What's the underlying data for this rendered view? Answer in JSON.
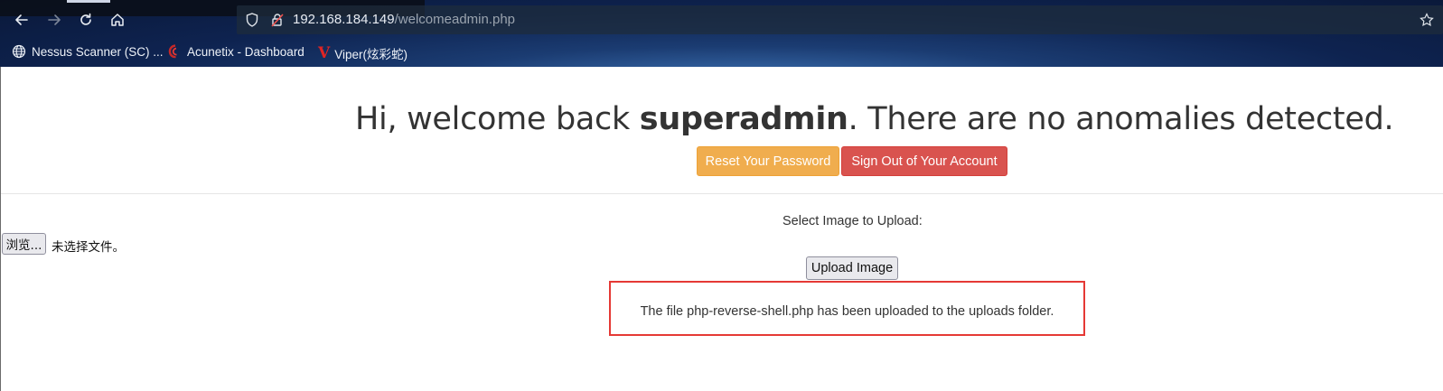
{
  "browser": {
    "url_host": "192.168.184.149",
    "url_path": "/welcomeadmin.php",
    "bookmarks": [
      {
        "label": "Nessus Scanner (SC) ...",
        "icon": "globe-icon"
      },
      {
        "label": "Acunetix - Dashboard",
        "icon": "acunetix-icon"
      },
      {
        "label": "Viper(炫彩蛇)",
        "icon": "viper-icon"
      }
    ]
  },
  "page": {
    "welcome_prefix": "Hi, welcome back ",
    "username": "superadmin",
    "welcome_suffix": ". There are no anomalies detected.",
    "reset_button": "Reset Your Password",
    "signout_button": "Sign Out of Your Account",
    "select_label": "Select Image to Upload:",
    "browse_button": "浏览...",
    "no_file_text": "未选择文件。",
    "upload_button": "Upload Image",
    "upload_message": "The file php-reverse-shell.php has been uploaded to the uploads folder."
  },
  "colors": {
    "warning": "#f0ad4e",
    "danger": "#d9534f",
    "highlight_border": "#e53935"
  }
}
